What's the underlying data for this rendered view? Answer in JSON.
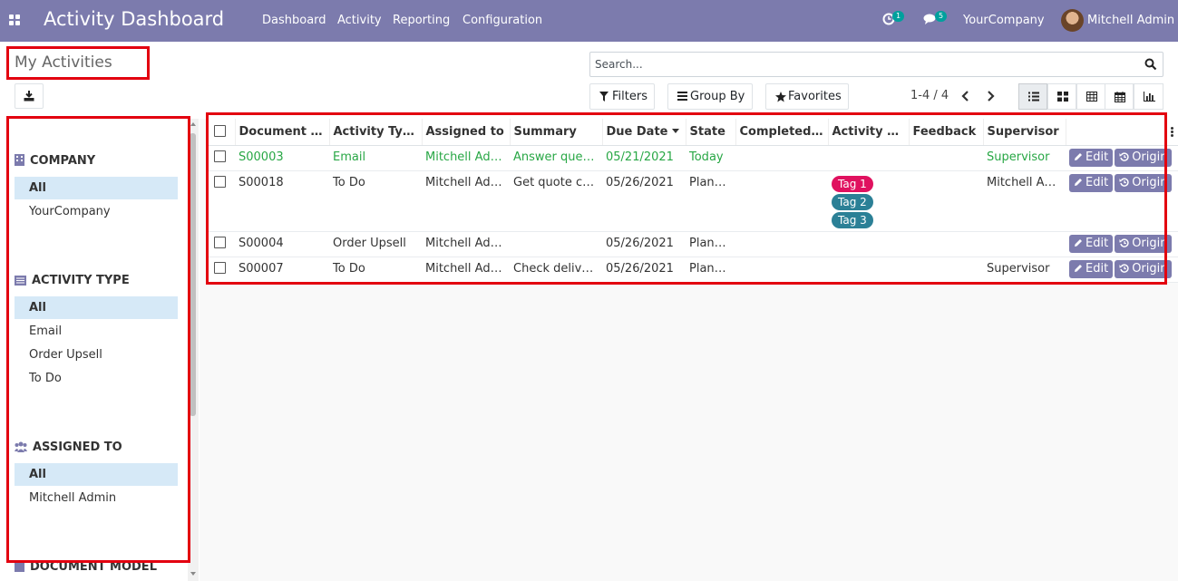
{
  "app": {
    "title": "Activity Dashboard"
  },
  "navbar": {
    "menus": [
      "Dashboard",
      "Activity",
      "Reporting",
      "Configuration"
    ],
    "activity_count": "1",
    "message_count": "5",
    "company": "YourCompany",
    "user": "Mitchell Admin"
  },
  "control_panel": {
    "breadcrumb": "My Activities",
    "search_placeholder": "Search...",
    "filters_label": "Filters",
    "group_by_label": "Group By",
    "favorites_label": "Favorites",
    "pager": "1-4 / 4",
    "views": [
      "list-view-icon",
      "kanban-view-icon",
      "pivot-view-icon",
      "calendar-view-icon",
      "graph-view-icon"
    ],
    "active_view": "list"
  },
  "side_panel": {
    "sections": [
      {
        "title": "COMPANY",
        "icon": "building-icon",
        "items": [
          "All",
          "YourCompany"
        ],
        "active": "All"
      },
      {
        "title": "ACTIVITY TYPE",
        "icon": "list-alt-icon",
        "items": [
          "All",
          "Email",
          "Order Upsell",
          "To Do"
        ],
        "active": "All"
      },
      {
        "title": "ASSIGNED TO",
        "icon": "users-icon",
        "items": [
          "All",
          "Mitchell Admin"
        ],
        "active": "All"
      },
      {
        "title": "DOCUMENT MODEL",
        "icon": "document-icon",
        "items": []
      }
    ]
  },
  "table": {
    "columns": [
      "Document N...",
      "Activity Type",
      "Assigned to",
      "Summary",
      "Due Date",
      "State",
      "Completed D...",
      "Activity Tags",
      "Feedback",
      "Supervisor"
    ],
    "sorted_column": "Due Date",
    "edit_label": "Edit",
    "origin_label": "Origin",
    "rows": [
      {
        "doc": "S00003",
        "type": "Email",
        "assigned": "Mitchell Admin",
        "summary": "Answer questi...",
        "due": "05/21/2021",
        "state": "Today",
        "completed": "",
        "tags": [],
        "feedback": "",
        "supervisor": "Supervisor",
        "status": "today"
      },
      {
        "doc": "S00018",
        "type": "To Do",
        "assigned": "Mitchell Admin",
        "summary": "Get quote con...",
        "due": "05/26/2021",
        "state": "Planned",
        "completed": "",
        "tags": [
          {
            "label": "Tag 1",
            "color": "#e0115f"
          },
          {
            "label": "Tag 2",
            "color": "#2b8096"
          },
          {
            "label": "Tag 3",
            "color": "#2b8096"
          }
        ],
        "feedback": "",
        "supervisor": "Mitchell Admin",
        "status": "planned"
      },
      {
        "doc": "S00004",
        "type": "Order Upsell",
        "assigned": "Mitchell Admin",
        "summary": "",
        "due": "05/26/2021",
        "state": "Planned",
        "completed": "",
        "tags": [],
        "feedback": "",
        "supervisor": "",
        "status": "planned"
      },
      {
        "doc": "S00007",
        "type": "To Do",
        "assigned": "Mitchell Admin",
        "summary": "Check deliver...",
        "due": "05/26/2021",
        "state": "Planned",
        "completed": "",
        "tags": [],
        "feedback": "",
        "supervisor": "Supervisor",
        "status": "planned"
      }
    ]
  },
  "colors": {
    "navbar": "#7c7bad",
    "annotation": "#e3000f",
    "today_text": "#28a745",
    "active_filter": "#d6e9f7"
  }
}
